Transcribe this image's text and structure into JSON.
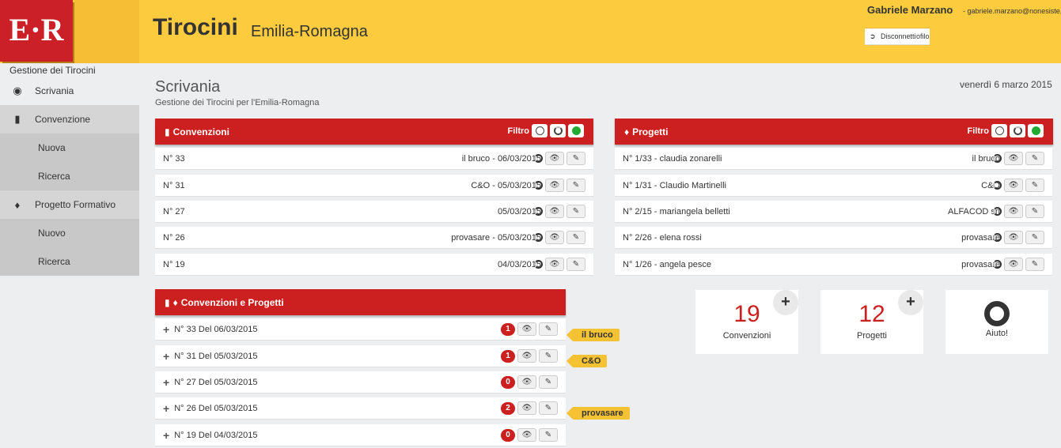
{
  "header": {
    "logo_text": "E·R",
    "app_title": "Tirocini",
    "app_subtitle": "Emilia-Romagna",
    "user_name": "Gabriele Marzano",
    "user_email": "- gabriele.marzano@nonesiste...",
    "menu": [
      {
        "label": "Modifica Profilo",
        "icon": "user-icon"
      },
      {
        "label": "Disconnetti",
        "icon": "logout-icon"
      }
    ]
  },
  "sidebar": {
    "title": "Gestione dei Tirocini",
    "items": [
      {
        "label": "Scrivania",
        "icon": "dashboard-icon"
      },
      {
        "label": "Convenzione",
        "icon": "bar-chart-icon"
      },
      {
        "label": "Nuova"
      },
      {
        "label": "Ricerca"
      },
      {
        "label": "Progetto Formativo",
        "icon": "cubes-icon"
      },
      {
        "label": "Nuovo"
      },
      {
        "label": "Ricerca"
      }
    ]
  },
  "main": {
    "title": "Scrivania",
    "subtitle": "Gestione dei Tirocini per l'Emilia-Romagna",
    "date": "venerdì 6 marzo 2015"
  },
  "convenzioni": {
    "title": "Convenzioni",
    "filter_label": "Filtro",
    "rows": [
      {
        "num": "N° 33",
        "info": "il bruco - 06/03/2015"
      },
      {
        "num": "N° 31",
        "info": "C&O - 05/03/2015"
      },
      {
        "num": "N° 27",
        "info": "05/03/2015"
      },
      {
        "num": "N° 26",
        "info": "provasare - 05/03/2015"
      },
      {
        "num": "N° 19",
        "info": "04/03/2015"
      }
    ]
  },
  "progetti": {
    "title": "Progetti",
    "filter_label": "Filtro",
    "rows": [
      {
        "num": "N° 1/33 - claudia zonarelli",
        "info": "il bruco"
      },
      {
        "num": "N° 1/31 - Claudio Martinelli",
        "info": "C&O"
      },
      {
        "num": "N° 2/15 - mariangela belletti",
        "info": "ALFACOD srl"
      },
      {
        "num": "N° 2/26 - elena rossi",
        "info": "provasare"
      },
      {
        "num": "N° 1/26 - angela pesce",
        "info": "provasare"
      }
    ]
  },
  "conv_prog": {
    "title": "Convenzioni e Progetti",
    "rows": [
      {
        "label": "N° 33 Del 06/03/2015",
        "count": "1",
        "tag": "il bruco"
      },
      {
        "label": "N° 31 Del 05/03/2015",
        "count": "1",
        "tag": "C&O"
      },
      {
        "label": "N° 27 Del 05/03/2015",
        "count": "0",
        "tag": ""
      },
      {
        "label": "N° 26 Del 05/03/2015",
        "count": "2",
        "tag": "provasare"
      },
      {
        "label": "N° 19 Del 04/03/2015",
        "count": "0",
        "tag": ""
      }
    ]
  },
  "tiles": [
    {
      "num": "19",
      "label": "Convenzioni",
      "has_add": true
    },
    {
      "num": "12",
      "label": "Progetti",
      "has_add": true
    },
    {
      "label": "Aiuto!",
      "icon": "lifebuoy-icon"
    }
  ],
  "colors": {
    "header": "#fdcc3e",
    "accent_red": "#cc1f1f",
    "tag_yellow": "#f5c234"
  }
}
